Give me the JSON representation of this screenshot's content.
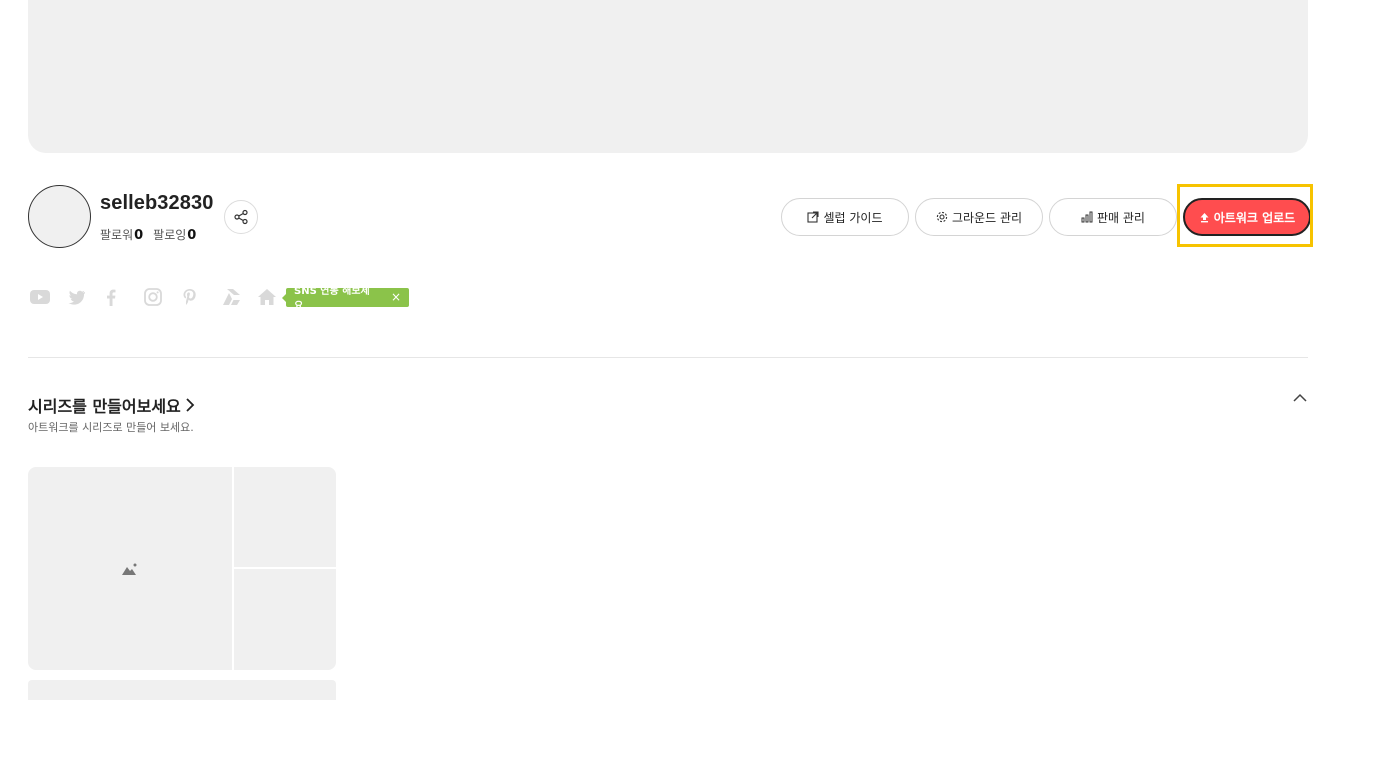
{
  "profile": {
    "username": "selleb32830",
    "followers_label": "팔로워",
    "followers_count": "0",
    "following_label": "팔로잉",
    "following_count": "0"
  },
  "actions": {
    "guide": "셀럽 가이드",
    "ground": "그라운드 관리",
    "sales": "판매 관리",
    "upload": "아트워크 업로드"
  },
  "sns": {
    "icons": [
      "youtube-icon",
      "twitter-icon",
      "facebook-icon",
      "instagram-icon",
      "pinterest-icon",
      "artstation-icon",
      "home-icon"
    ],
    "tooltip": "SNS 연동 해보세요.",
    "tooltip_close": "×"
  },
  "series": {
    "title": "시리즈를 만들어보세요",
    "subtitle": "아트워크를 시리즈로 만들어 보세요."
  },
  "colors": {
    "accent": "#ff4d4f",
    "sns_tip": "#8bc34a",
    "highlight": "#f7c300",
    "placeholder": "#f0f0f0"
  }
}
